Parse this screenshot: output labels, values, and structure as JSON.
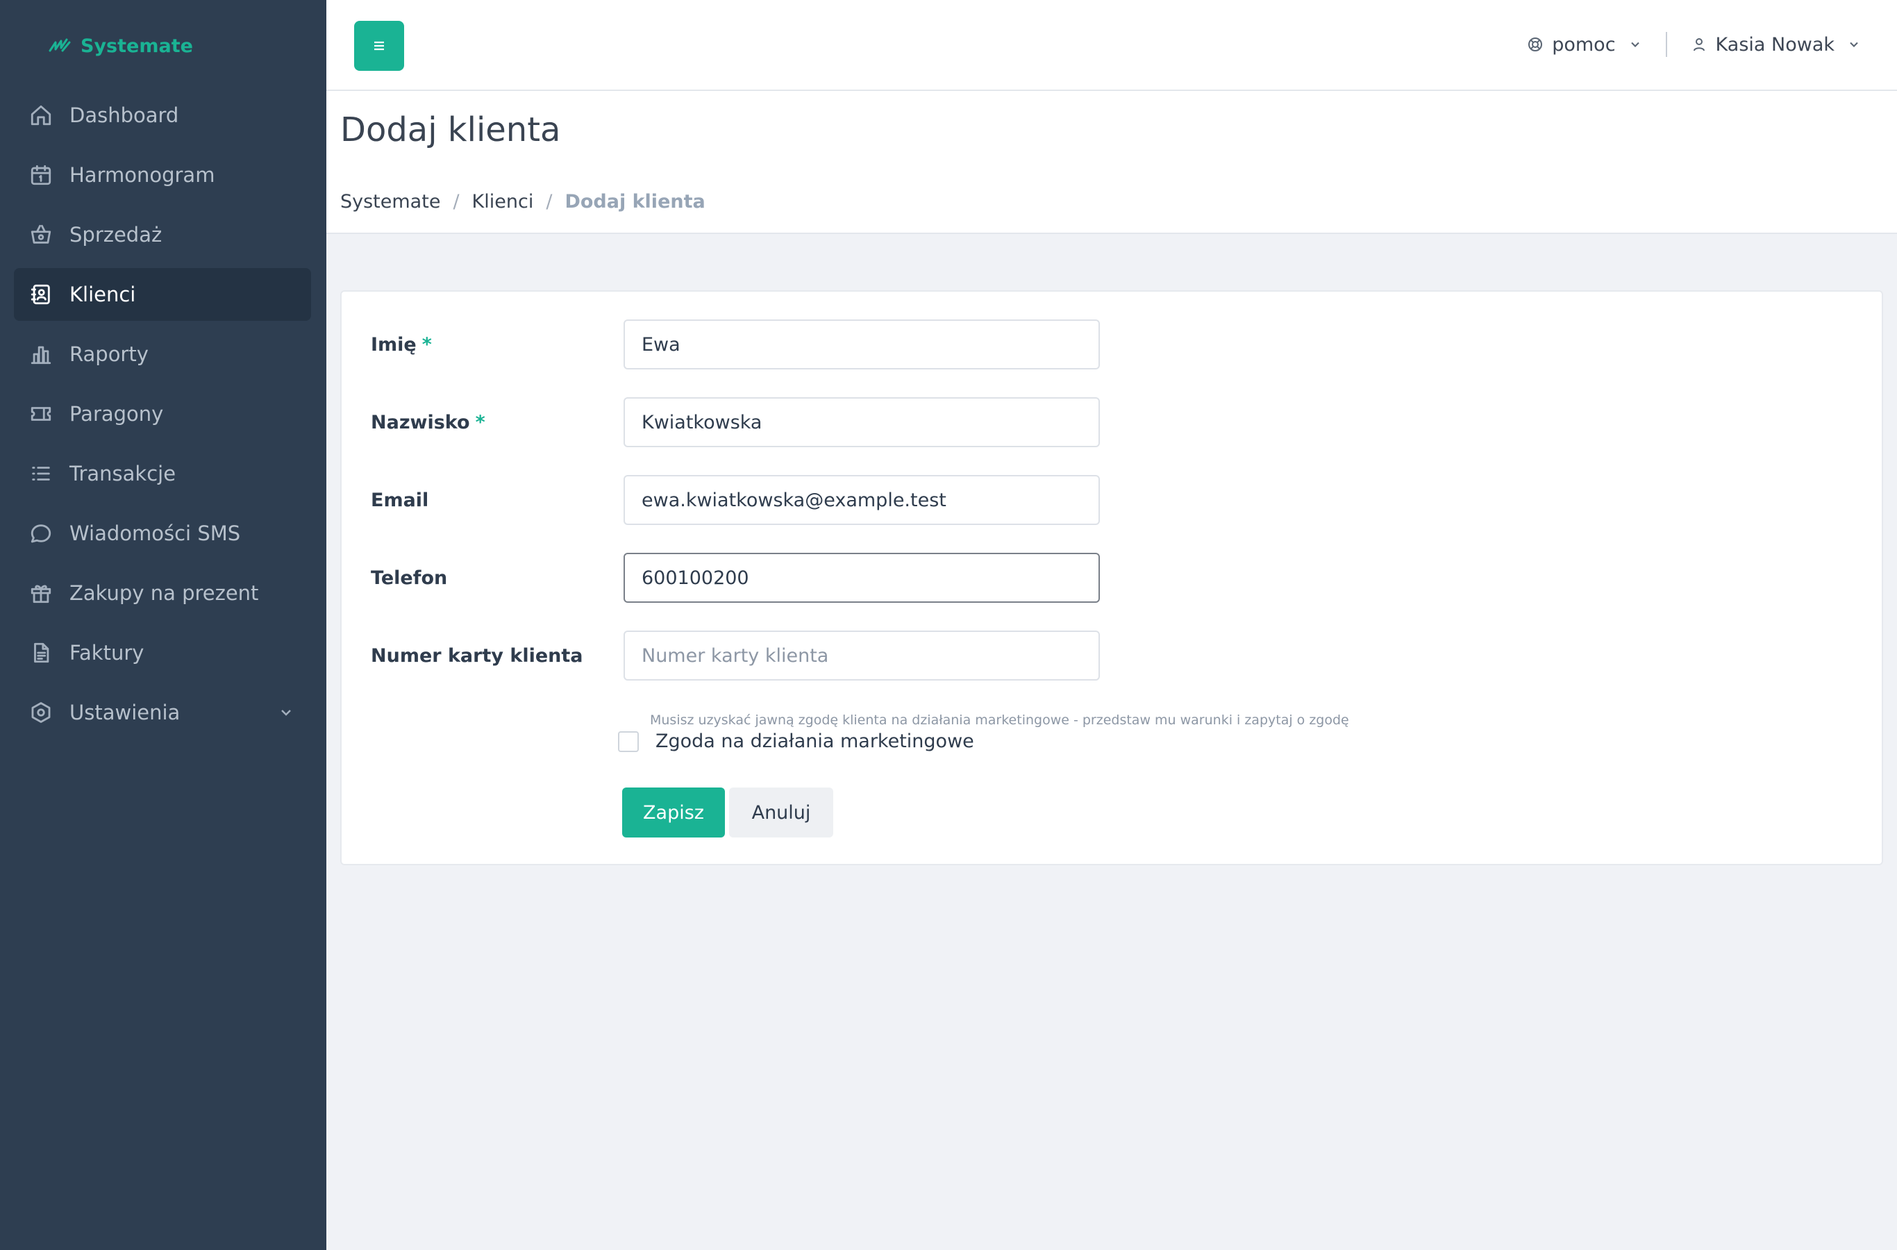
{
  "brand": {
    "name": "Systemate"
  },
  "sidebar": {
    "items": [
      {
        "label": "Dashboard",
        "icon": "home-icon"
      },
      {
        "label": "Harmonogram",
        "icon": "calendar-icon"
      },
      {
        "label": "Sprzedaż",
        "icon": "basket-icon"
      },
      {
        "label": "Klienci",
        "icon": "contacts-icon",
        "active": true
      },
      {
        "label": "Raporty",
        "icon": "bar-chart-icon"
      },
      {
        "label": "Paragony",
        "icon": "ticket-icon"
      },
      {
        "label": "Transakcje",
        "icon": "list-icon"
      },
      {
        "label": "Wiadomości SMS",
        "icon": "chat-bubble-icon"
      },
      {
        "label": "Zakupy na prezent",
        "icon": "gift-icon"
      },
      {
        "label": "Faktury",
        "icon": "document-icon"
      },
      {
        "label": "Ustawienia",
        "icon": "settings-hexagon-icon",
        "has_submenu": true
      }
    ]
  },
  "topbar": {
    "help_label": "pomoc",
    "user_name": "Kasia Nowak"
  },
  "page": {
    "title": "Dodaj klienta",
    "breadcrumb": [
      "Systemate",
      "Klienci",
      "Dodaj klienta"
    ]
  },
  "form": {
    "required_mark": "*",
    "first_name": {
      "label": "Imię",
      "value": "Ewa"
    },
    "last_name": {
      "label": "Nazwisko",
      "value": "Kwiatkowska"
    },
    "email": {
      "label": "Email",
      "value": "ewa.kwiatkowska@example.test"
    },
    "phone": {
      "label": "Telefon",
      "value": "600100200"
    },
    "card_number": {
      "label": "Numer karty klienta",
      "value": "",
      "placeholder": "Numer karty klienta"
    },
    "consent_note": "Musisz uzyskać jawną zgodę klienta na działania marketingowe - przedstaw mu warunki i zapytaj o zgodę",
    "consent_label": "Zgoda na działania marketingowe",
    "consent_checked": false,
    "save_label": "Zapisz",
    "cancel_label": "Anuluj"
  },
  "colors": {
    "accent": "#1ab394",
    "sidebar_bg": "#2e3e51",
    "sidebar_active_bg": "#243344",
    "page_bg": "#f0f2f6"
  }
}
